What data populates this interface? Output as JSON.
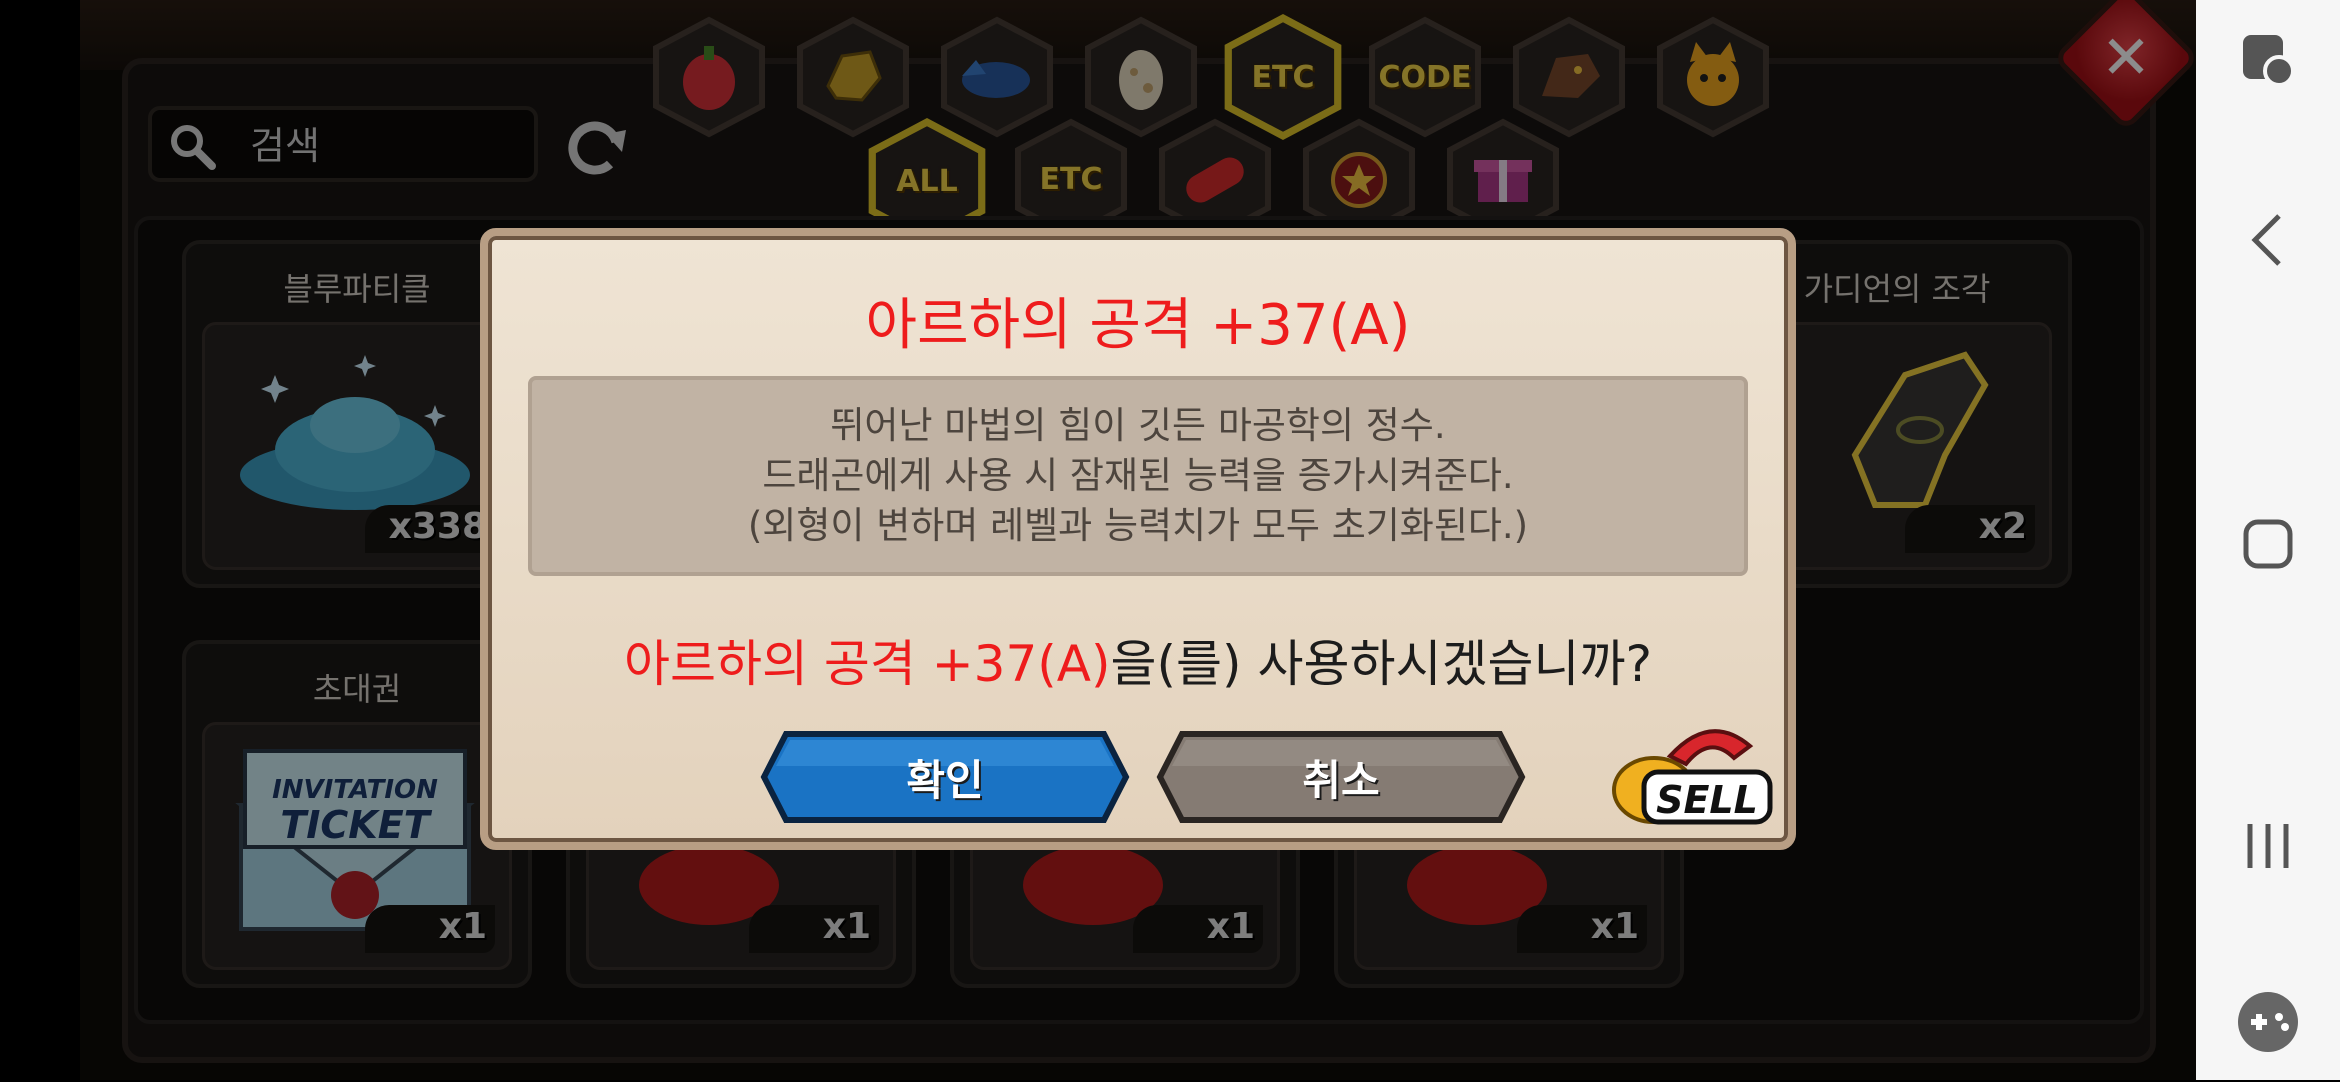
{
  "search": {
    "placeholder": "검색"
  },
  "category_tabs_top": [
    "ETC",
    "CODE"
  ],
  "category_tabs_bottom": [
    "ALL",
    "ETC"
  ],
  "items": [
    {
      "name": "블루파티클",
      "qty": "x338"
    },
    {
      "name": "가디언의 조각",
      "qty": "x2"
    },
    {
      "name": "초대권",
      "qty": "x1",
      "ticket_line1": "INVITATION",
      "ticket_line2": "TICKET"
    },
    {
      "qty": "x1"
    },
    {
      "qty": "x1"
    },
    {
      "qty": "x1"
    }
  ],
  "dialog": {
    "title": "아르하의 공격 +37(A)",
    "description": [
      "뛰어난 마법의 힘이 깃든 마공학의 정수.",
      "드래곤에게 사용 시 잠재된 능력을 증가시켜준다.",
      "(외형이 변하며 레벨과 능력치가 모두 초기화된다.)"
    ],
    "question_item": "아르하의 공격 +37(A)",
    "question_suffix": "을(를) 사용하시겠습니까?",
    "confirm_label": "확인",
    "cancel_label": "취소",
    "sell_label": "SELL"
  },
  "colors": {
    "title_red": "#ee1c1c",
    "confirm_blue": "#0f63b4",
    "cancel_gray": "#8a8079",
    "tab_gold": "#f2d34a"
  }
}
